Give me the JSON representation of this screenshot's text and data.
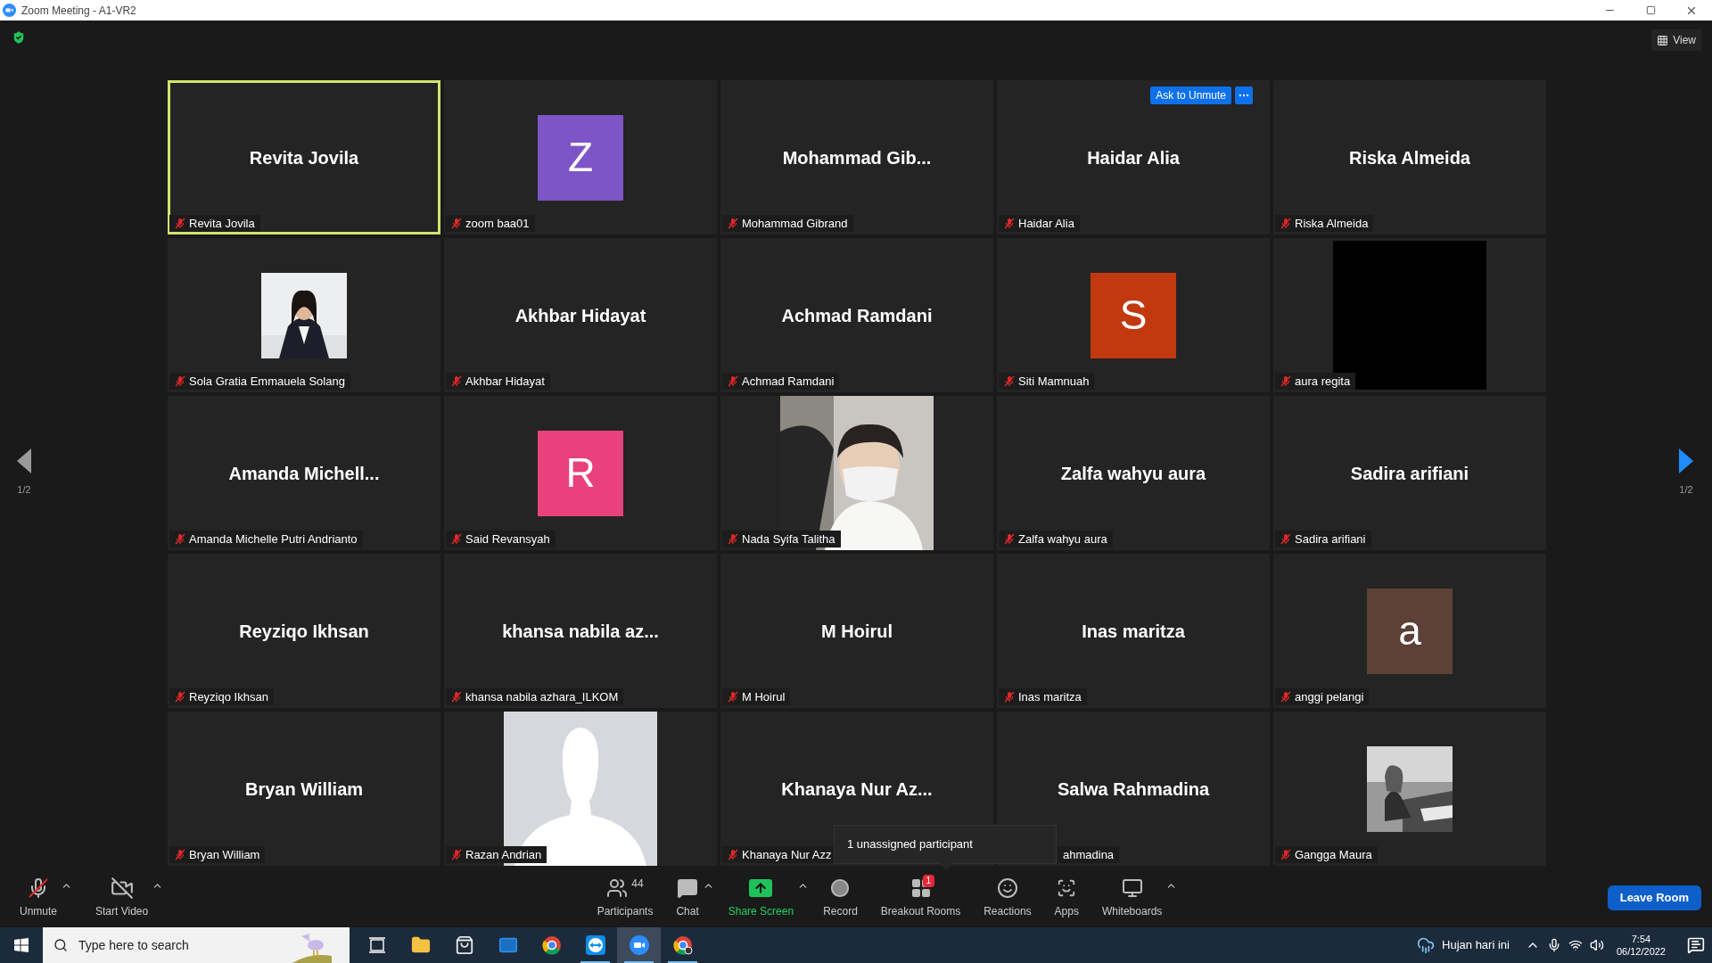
{
  "window": {
    "title": "Zoom Meeting - A1-VR2"
  },
  "top_bar": {
    "view_button": "View"
  },
  "pagination": [
    {
      "text": "1/2",
      "disabled": true
    },
    {
      "text": "1/2",
      "disabled": false
    }
  ],
  "tiles": [
    {
      "kind": "name",
      "display": "Revita Jovila",
      "label": "Revita Jovila",
      "muted": true,
      "highlighted": true
    },
    {
      "kind": "avatar",
      "display": "Z",
      "color": "#7e55c6",
      "label": "zoom baa01",
      "muted": true,
      "highlighted": false
    },
    {
      "kind": "name",
      "display": "Mohammad  Gib...",
      "label": "Mohammad Gibrand",
      "muted": true,
      "highlighted": false
    },
    {
      "kind": "name",
      "display": "Haidar Alia",
      "label": "Haidar Alia",
      "muted": true,
      "highlighted": false,
      "ask_button": "Ask to Unmute"
    },
    {
      "kind": "name",
      "display": "Riska Almeida",
      "label": "Riska Almeida",
      "muted": true,
      "highlighted": false
    },
    {
      "label": "Sola Gratia Emmauela Solang",
      "muted": true,
      "highlighted": false
    },
    {
      "kind": "name",
      "display": "Akhbar Hidayat",
      "label": "Akhbar Hidayat",
      "muted": true,
      "highlighted": false
    },
    {
      "kind": "name",
      "display": "Achmad Ramdani",
      "label": "Achmad Ramdani",
      "muted": true,
      "highlighted": false
    },
    {
      "kind": "avatar",
      "display": "S",
      "color": "#c2390f",
      "label": "Siti Mamnuah",
      "muted": true,
      "highlighted": false
    },
    {
      "kind": "video_dark",
      "label": "aura regita",
      "muted": true,
      "highlighted": false
    },
    {
      "kind": "name",
      "display": "Amanda  Michell...",
      "label": "Amanda Michelle Putri Andrianto",
      "muted": true,
      "highlighted": false
    },
    {
      "kind": "avatar",
      "display": "R",
      "color": "#e9417c",
      "label": "Said Revansyah",
      "muted": true,
      "highlighted": false
    },
    {
      "kind": "camera",
      "label": "Nada Syifa Talitha",
      "muted": true,
      "highlighted": false
    },
    {
      "kind": "name",
      "display": "Zalfa wahyu aura",
      "label": "Zalfa wahyu aura",
      "muted": true,
      "highlighted": false
    },
    {
      "kind": "name",
      "display": "Sadira arifiani",
      "label": "Sadira arifiani",
      "muted": true,
      "highlighted": false
    },
    {
      "kind": "name",
      "display": "Reyziqo Ikhsan",
      "label": "Reyziqo Ikhsan",
      "muted": true,
      "highlighted": false
    },
    {
      "kind": "name",
      "display": "khansa nabila az...",
      "label": "khansa nabila azhara_ILKOM",
      "muted": true,
      "highlighted": false
    },
    {
      "kind": "name",
      "display": "M Hoirul",
      "label": "M Hoirul",
      "muted": true,
      "highlighted": false
    },
    {
      "kind": "name",
      "display": "Inas maritza",
      "label": "Inas maritza",
      "muted": true,
      "highlighted": false
    },
    {
      "kind": "avatar",
      "display": "a",
      "color": "#5d4036",
      "label": "anggi pelangi",
      "muted": true,
      "highlighted": false
    },
    {
      "kind": "name",
      "display": "Bryan William",
      "label": "Bryan William",
      "muted": true,
      "highlighted": false
    },
    {
      "kind": "default_avatar",
      "label": "Razan Andrian",
      "muted": true,
      "highlighted": false
    },
    {
      "kind": "name",
      "display": "Khanaya Nur Az...",
      "label": "Khanaya Nur Azz",
      "muted": true,
      "highlighted": false
    },
    {
      "kind": "name",
      "display": "Salwa Rahmadina",
      "label": "ahmadina",
      "highlighted": false,
      "label_covered": true
    },
    {
      "kind": "photo_grey",
      "label": "Gangga Maura",
      "muted": true,
      "highlighted": false
    }
  ],
  "tooltip": {
    "text": "1 unassigned participant"
  },
  "toolbar": {
    "left": [
      {
        "kind": "mic",
        "label": "Unmute",
        "caret": true
      },
      {
        "kind": "video",
        "label": "Start Video",
        "caret": true
      }
    ],
    "center": [
      {
        "kind": "participants",
        "label": "Participants",
        "count": "44",
        "caret": false
      },
      {
        "kind": "chat",
        "label": "Chat",
        "caret": true
      },
      {
        "kind": "share",
        "label": "Share Screen",
        "caret": true
      },
      {
        "kind": "record",
        "label": "Record",
        "caret": false
      },
      {
        "kind": "breakout",
        "label": "Breakout Rooms",
        "badge": "1",
        "caret": false
      },
      {
        "kind": "reactions",
        "label": "Reactions",
        "caret": false
      },
      {
        "kind": "apps",
        "label": "Apps",
        "caret": false
      },
      {
        "kind": "whiteboard",
        "label": "Whiteboards",
        "caret": true
      }
    ],
    "leave_button": "Leave Room"
  },
  "taskbar": {
    "search_placeholder": "Type here to search",
    "apps": [
      {
        "kind": "task_view",
        "running": false,
        "active": false
      },
      {
        "kind": "explorer",
        "running": false,
        "active": false
      },
      {
        "kind": "store",
        "running": false,
        "active": false
      },
      {
        "kind": "mail",
        "running": false,
        "active": false
      },
      {
        "kind": "chrome",
        "running": false,
        "active": false
      },
      {
        "kind": "teamviewer",
        "running": true,
        "active": false
      },
      {
        "kind": "zoom",
        "running": true,
        "active": true
      },
      {
        "kind": "chrome_profile",
        "running": true,
        "active": false
      }
    ],
    "weather": "Hujan hari ini",
    "time": "7:54",
    "date": "06/12/2022"
  }
}
